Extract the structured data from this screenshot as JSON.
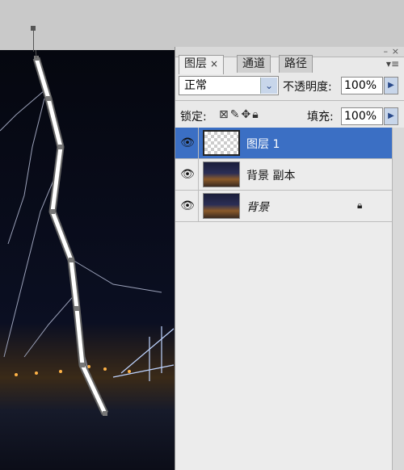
{
  "panel": {
    "tabs": [
      {
        "label": "图层",
        "close": "×"
      },
      {
        "label": "通道"
      },
      {
        "label": "路径"
      }
    ],
    "blend_mode": "正常",
    "opacity_label": "不透明度:",
    "opacity_value": "100%",
    "lock_label": "锁定:",
    "fill_label": "填充:",
    "fill_value": "100%",
    "layers": [
      {
        "name": "图层 1",
        "selected": true
      },
      {
        "name": "背景 副本"
      },
      {
        "name": "背景",
        "locked": true
      }
    ]
  },
  "icons": {
    "eye": "eye-icon",
    "lock": "lock-icon",
    "menu": "panel-menu-icon",
    "dropdown": "chevron-down-icon"
  }
}
